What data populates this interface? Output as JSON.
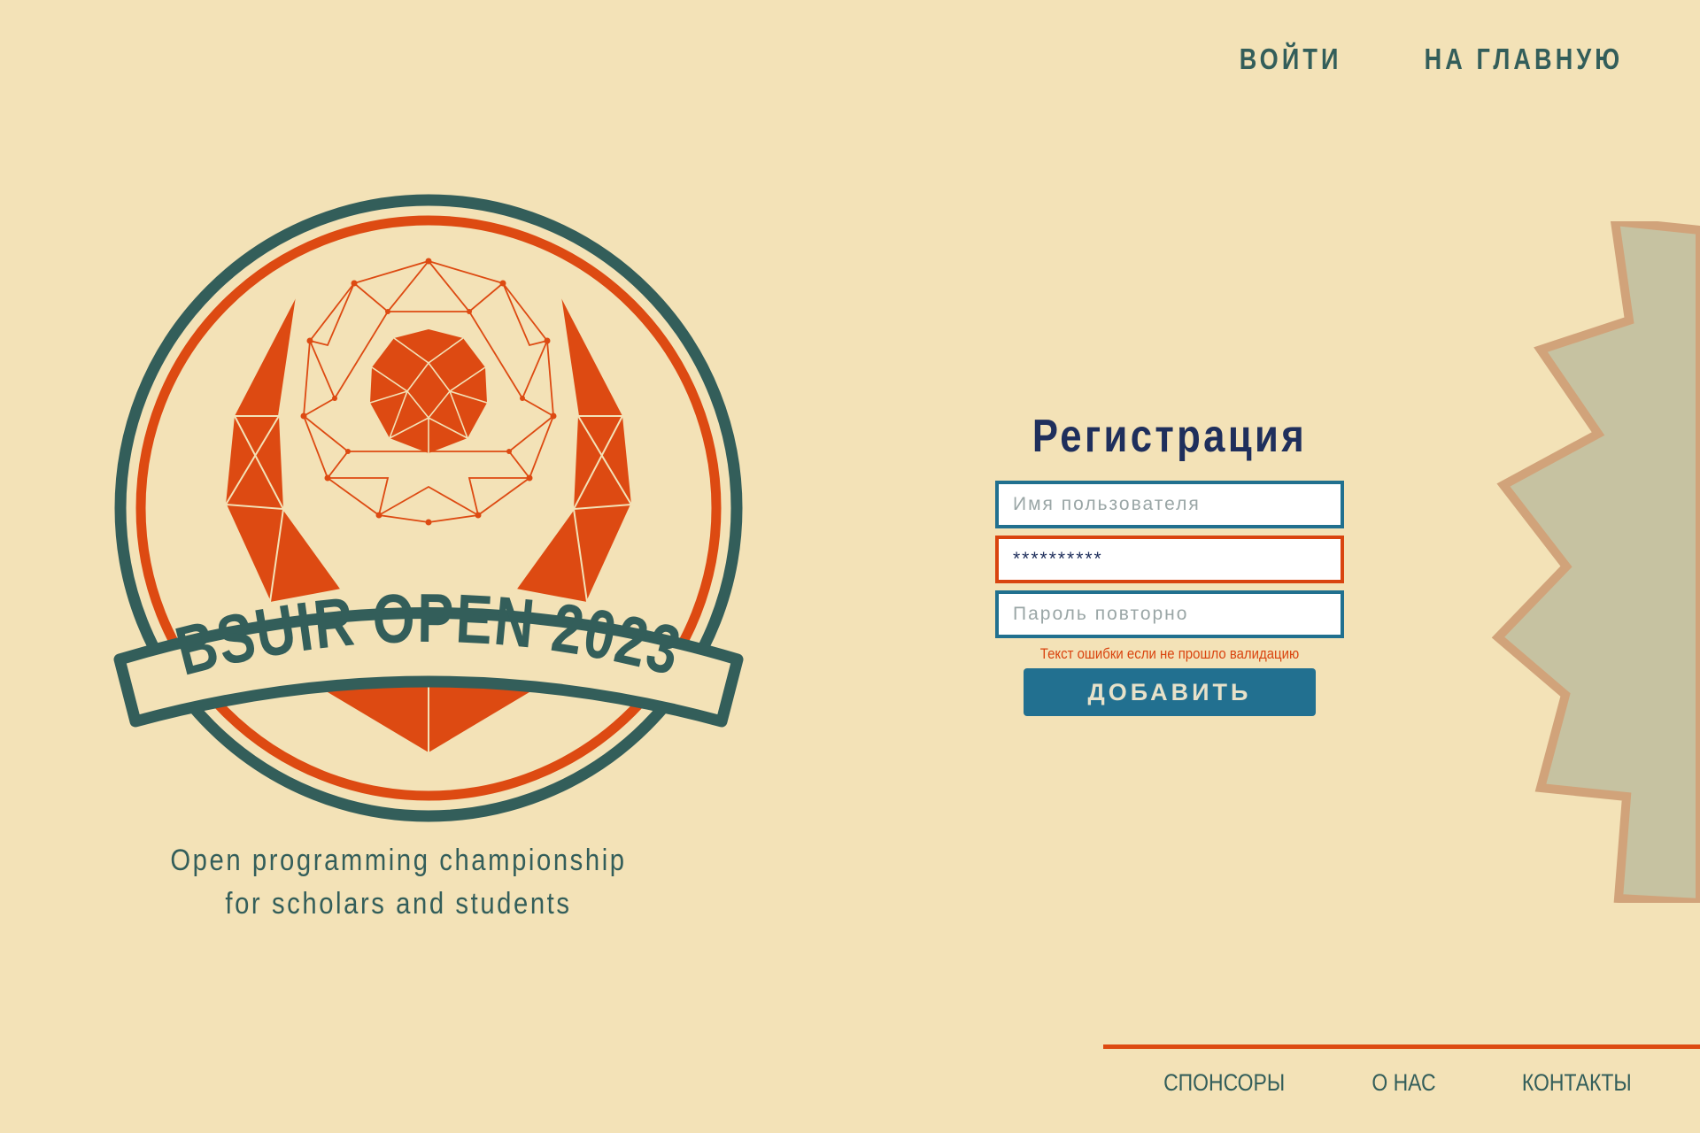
{
  "top_nav": {
    "login": "ВОЙТИ",
    "home": "НА ГЛАВНУЮ"
  },
  "logo": {
    "banner_text": "BSUIR OPEN 2023"
  },
  "tagline": {
    "line1": "Open programming championship",
    "line2": "for scholars and students"
  },
  "form": {
    "title": "Регистрация",
    "username": {
      "placeholder": "Имя пользователя",
      "value": ""
    },
    "password": {
      "value": "**********"
    },
    "password_repeat": {
      "placeholder": "Пароль повторно",
      "value": ""
    },
    "error_text": "Текст ошибки если не прошло валидацию",
    "submit_label": "ДОБАВИТЬ"
  },
  "footer": {
    "links": [
      "СПОНСОРЫ",
      "О НАС",
      "КОНТАКТЫ"
    ]
  },
  "colors": {
    "background": "#f3e2b7",
    "teal": "#335e5a",
    "orange": "#dd4a12",
    "navy": "#1f2f5c",
    "button": "#227090",
    "star_fill": "#c6c2a1",
    "star_border": "#d1a37a"
  }
}
